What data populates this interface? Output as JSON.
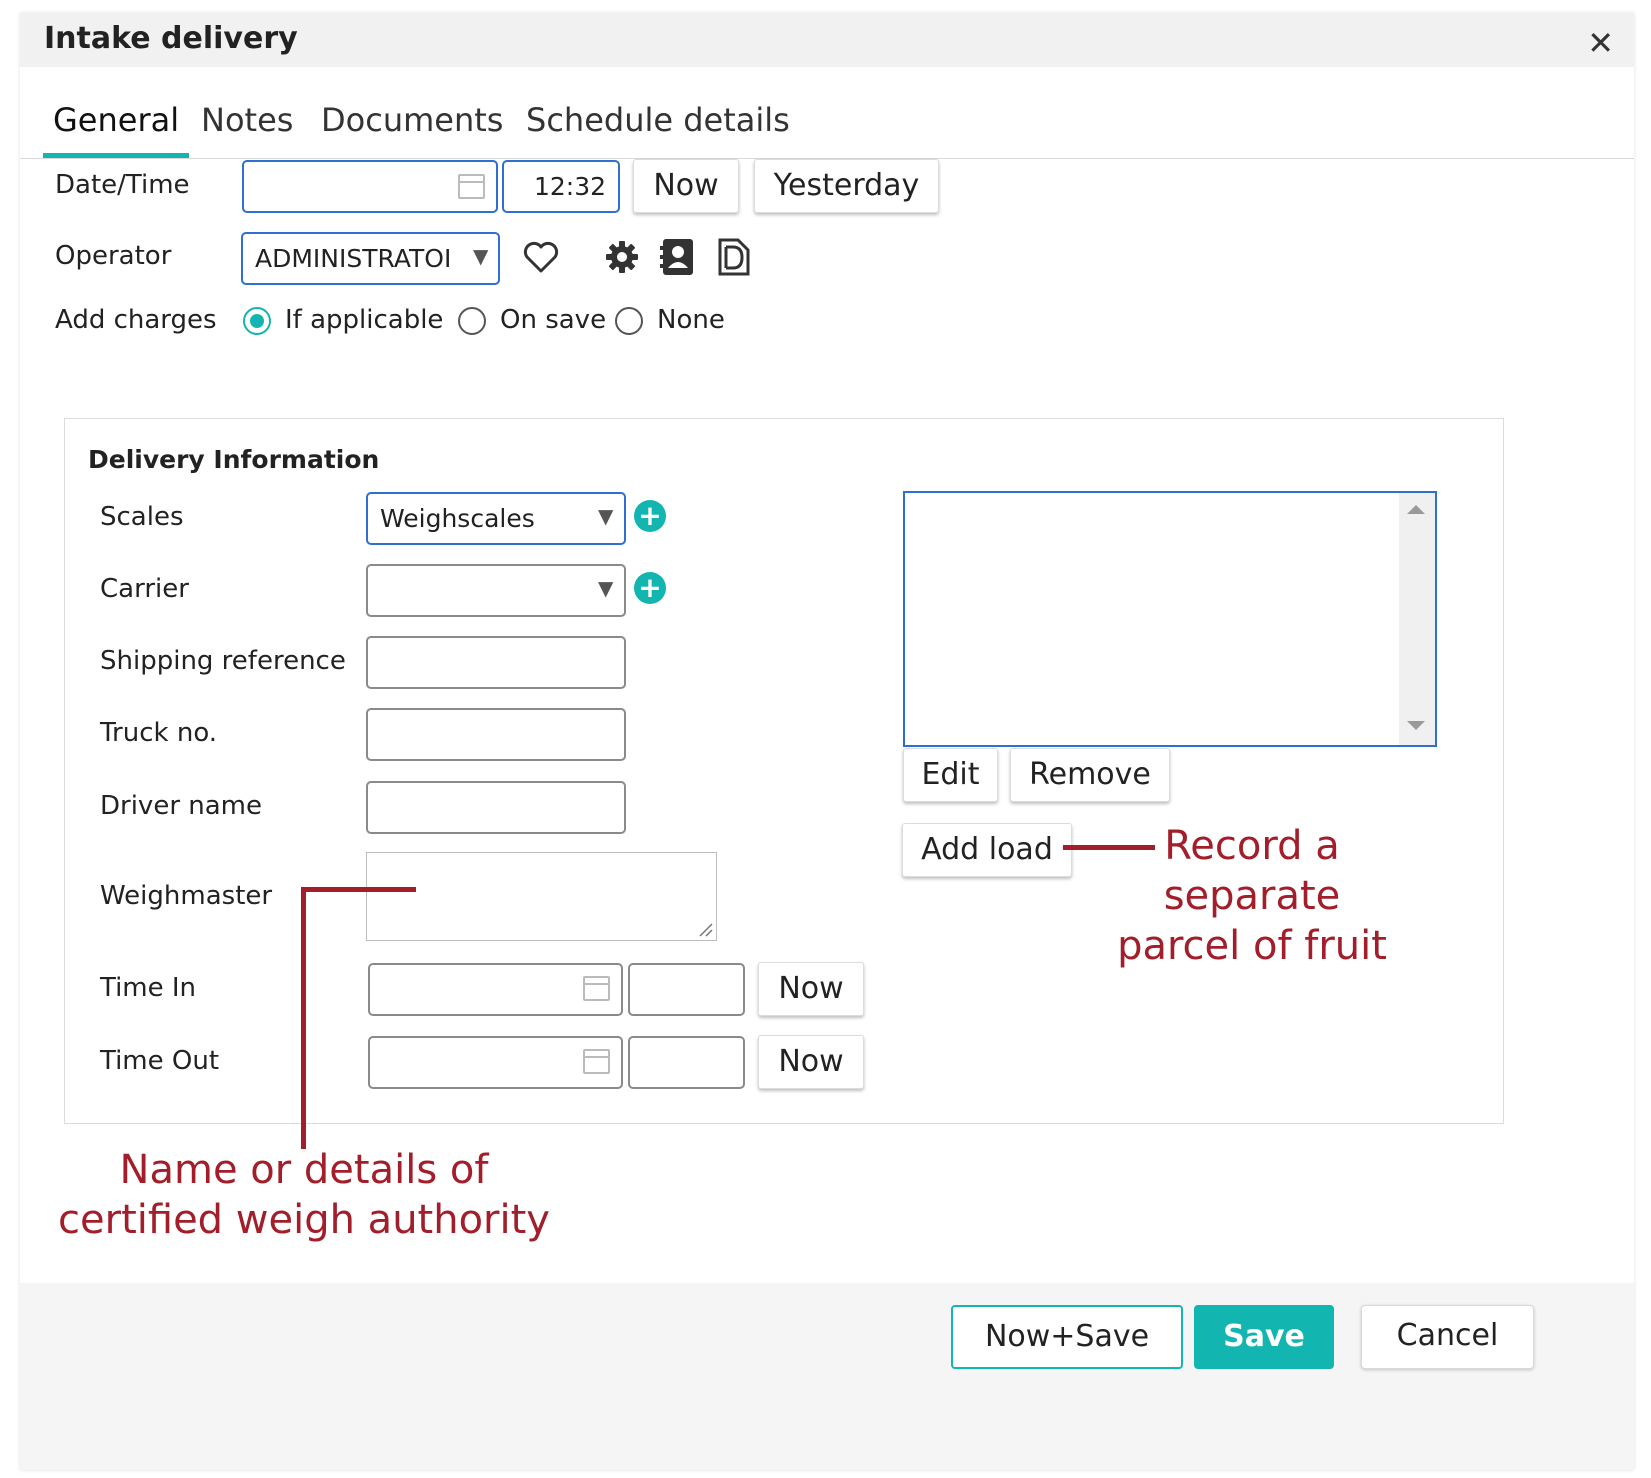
{
  "dialog": {
    "title": "Intake delivery",
    "close_symbol": "✕"
  },
  "tabs": [
    {
      "label": "General",
      "active": true
    },
    {
      "label": "Notes"
    },
    {
      "label": "Documents"
    },
    {
      "label": "Schedule details"
    }
  ],
  "general": {
    "datetime_label": "Date/Time",
    "date_value": "",
    "time_value": "12:32",
    "now_label": "Now",
    "yesterday_label": "Yesterday",
    "operator_label": "Operator",
    "operator_value": "ADMINISTRATOI",
    "add_charges_label": "Add charges",
    "charge_options": [
      "If applicable",
      "On save",
      "None"
    ],
    "charge_selected": "If applicable"
  },
  "delivery": {
    "section_title": "Delivery Information",
    "scales_label": "Scales",
    "scales_value": "Weighscales",
    "carrier_label": "Carrier",
    "carrier_value": "",
    "shipping_reference_label": "Shipping reference",
    "truck_no_label": "Truck no.",
    "driver_name_label": "Driver name",
    "weighmaster_label": "Weighmaster",
    "time_in_label": "Time In",
    "time_out_label": "Time Out",
    "now_label": "Now",
    "edit_label": "Edit",
    "remove_label": "Remove",
    "add_load_label": "Add load"
  },
  "annotations": {
    "add_load_note": [
      "Record a",
      "separate",
      "parcel of fruit"
    ],
    "weighmaster_note": [
      "Name or details of",
      "certified weigh authority"
    ],
    "color": "#a11e2a"
  },
  "footer": {
    "now_save_label": "Now+Save",
    "save_label": "Save",
    "cancel_label": "Cancel"
  },
  "colors": {
    "accent": "#13b5b0",
    "focus_border": "#2f6fd1"
  },
  "icons": [
    "calendar-icon",
    "heart-icon",
    "gear-icon",
    "contact-card-icon",
    "document-icon",
    "plus-circle-icon",
    "close-icon"
  ]
}
